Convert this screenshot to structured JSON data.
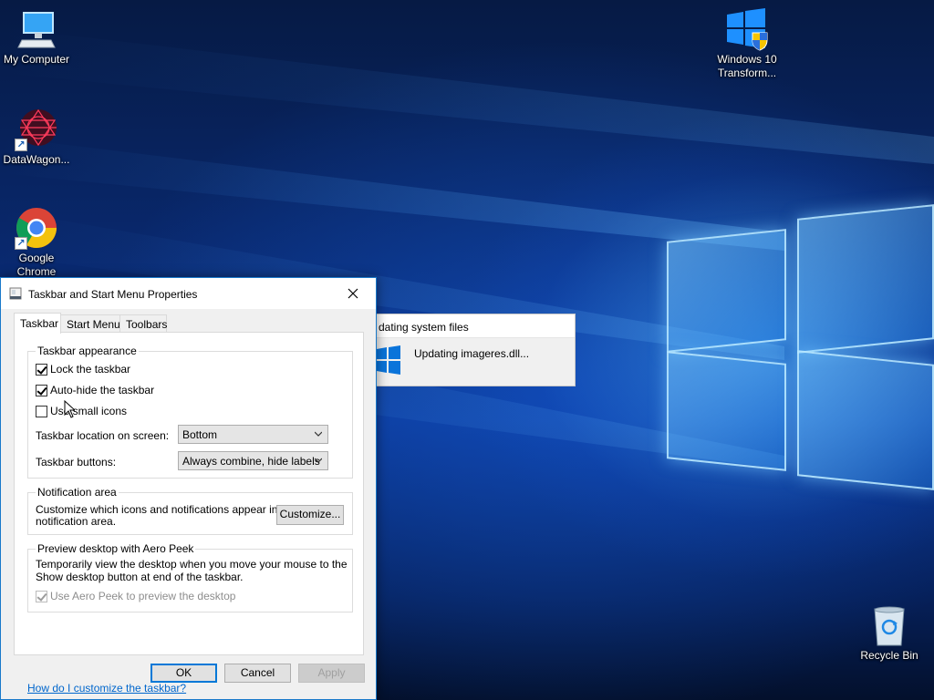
{
  "desktop": {
    "icons": [
      {
        "label": "My Computer",
        "icon": "monitor-icon"
      },
      {
        "label": "DataWagon...",
        "icon": "datawagon-icon"
      },
      {
        "label": "Google Chrome",
        "icon": "chrome-icon"
      },
      {
        "label": "Windows 10 Transform...",
        "icon": "windows-shield-icon"
      },
      {
        "label": "Recycle Bin",
        "icon": "recycle-bin-icon"
      }
    ]
  },
  "update_window": {
    "title": "dating system files",
    "message": "Updating imageres.dll..."
  },
  "dialog": {
    "title": "Taskbar and Start Menu Properties",
    "tabs": [
      {
        "label": "Taskbar",
        "active": true
      },
      {
        "label": "Start Menu",
        "active": false
      },
      {
        "label": "Toolbars",
        "active": false
      }
    ],
    "appearance": {
      "group_label": "Taskbar appearance",
      "lock": {
        "label": "Lock the taskbar",
        "checked": true
      },
      "autohide": {
        "label": "Auto-hide the taskbar",
        "checked": true
      },
      "small_icons": {
        "label": "Use small icons",
        "checked": false
      },
      "location_label": "Taskbar location on screen:",
      "location_value": "Bottom",
      "buttons_label": "Taskbar buttons:",
      "buttons_value": "Always combine, hide labels"
    },
    "notification": {
      "group_label": "Notification area",
      "description_line1": "Customize which icons and notifications appear in the",
      "description_line2": "notification area.",
      "customize_label": "Customize..."
    },
    "peek": {
      "group_label": "Preview desktop with Aero Peek",
      "description_line1": "Temporarily view the desktop when you move your mouse to the",
      "description_line2": "Show desktop button at end of the taskbar.",
      "checkbox": {
        "label": "Use Aero Peek to preview the desktop",
        "checked": true,
        "enabled": false
      }
    },
    "help_link": "How do I customize the taskbar?",
    "buttons": {
      "ok": "OK",
      "cancel": "Cancel",
      "apply": "Apply"
    }
  },
  "colors": {
    "accent": "#0078d7",
    "link": "#0066cc",
    "dialog_bg": "#f0f0f0"
  }
}
